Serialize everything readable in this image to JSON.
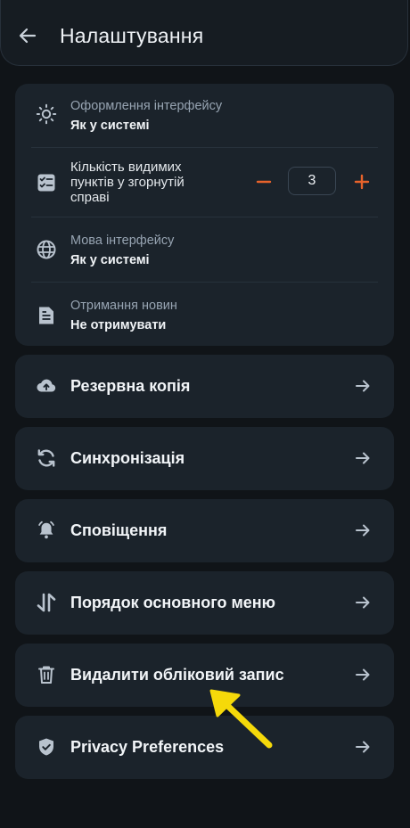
{
  "header": {
    "title": "Налаштування",
    "back_icon": "arrow-left-icon"
  },
  "settings": {
    "theme": {
      "label": "Оформлення інтерфейсу",
      "value": "Як у системі",
      "icon": "sun-icon"
    },
    "visible_items": {
      "label": "Кількість видимих пунктів у згорнутій справі",
      "value": "3",
      "icon": "checklist-icon"
    },
    "language": {
      "label": "Мова інтерфейсу",
      "value": "Як у системі",
      "icon": "globe-icon"
    },
    "news": {
      "label": "Отримання новин",
      "value": "Не отримувати",
      "icon": "document-icon"
    }
  },
  "nav": [
    {
      "label": "Резервна копія",
      "icon": "cloud-upload-icon"
    },
    {
      "label": "Синхронізація",
      "icon": "sync-icon"
    },
    {
      "label": "Сповіщення",
      "icon": "bell-icon"
    },
    {
      "label": "Порядок основного меню",
      "icon": "reorder-icon"
    },
    {
      "label": "Видалити обліковий запис",
      "icon": "trash-icon"
    },
    {
      "label": "Privacy Preferences",
      "icon": "shield-icon"
    }
  ],
  "colors": {
    "background": "#101418",
    "card": "#1b232b",
    "accent_orange": "#e8632b",
    "annotation_yellow": "#f5d90a",
    "icon": "#b9c3ce"
  }
}
